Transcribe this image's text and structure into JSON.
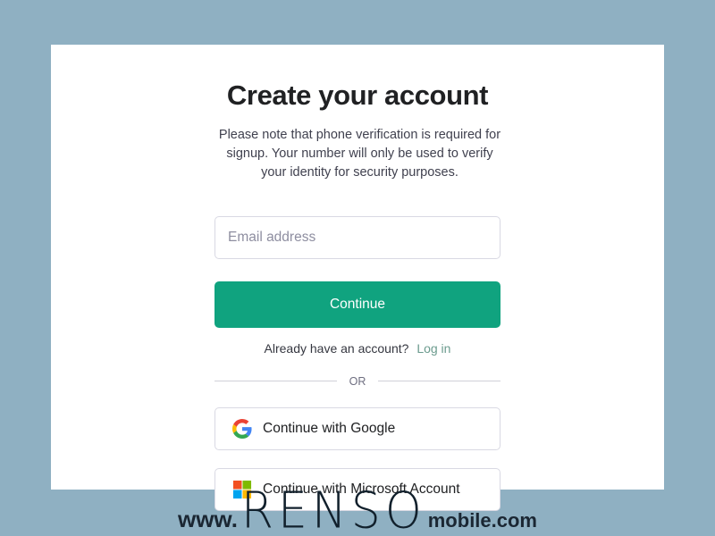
{
  "theme": {
    "page_background": "#8fb0c2",
    "card_background": "#ffffff",
    "accent_green": "#10a37f",
    "link_green": "#6b9b8e",
    "text_dark": "#202123",
    "border_gray": "#d9d9e3"
  },
  "signup": {
    "title": "Create your account",
    "subtitle": "Please note that phone verification is required for signup. Your number will only be used to verify your identity for security purposes.",
    "email": {
      "placeholder": "Email address",
      "value": ""
    },
    "continue_label": "Continue",
    "login_prompt": "Already have an account?",
    "login_link_label": "Log in",
    "divider_label": "OR",
    "social_buttons": [
      {
        "label": "Continue with Google",
        "icon": "google-icon"
      },
      {
        "label": "Continue with Microsoft Account",
        "icon": "microsoft-icon"
      }
    ]
  },
  "watermark": {
    "prefix": "www.",
    "brand": "RENSO",
    "suffix": "mobile.com"
  }
}
